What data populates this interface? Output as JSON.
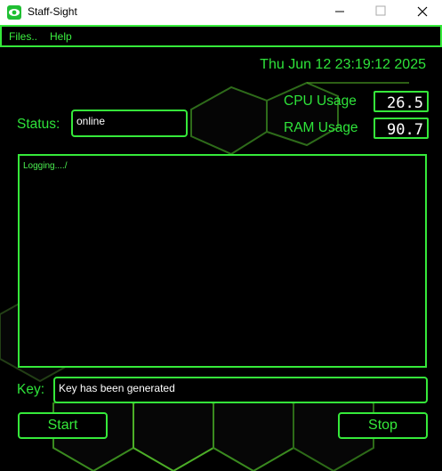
{
  "window": {
    "title": "Staff-Sight",
    "minimize_glyph": "—",
    "maximize_glyph": "☐",
    "close_glyph": "✕"
  },
  "menu": {
    "items": [
      {
        "label": "Files.."
      },
      {
        "label": "Help"
      }
    ]
  },
  "header": {
    "datetime": "Thu Jun 12 23:19:12 2025"
  },
  "stats": {
    "cpu_label": "CPU Usage",
    "cpu_value": "26.5",
    "ram_label": "RAM Usage",
    "ram_value": "90.7"
  },
  "status": {
    "label": "Status:",
    "value": "online"
  },
  "log": {
    "text": "Logging..../"
  },
  "key": {
    "label": "Key:",
    "value": "Key has been generated"
  },
  "buttons": {
    "start": "Start",
    "stop": "Stop"
  },
  "colors": {
    "accent": "#35e93a",
    "background": "#000000",
    "text_light": "#ffffff"
  },
  "icons": {
    "app": "eye-logo-icon",
    "minimize": "minimize-icon",
    "maximize": "maximize-icon",
    "close": "close-icon"
  }
}
